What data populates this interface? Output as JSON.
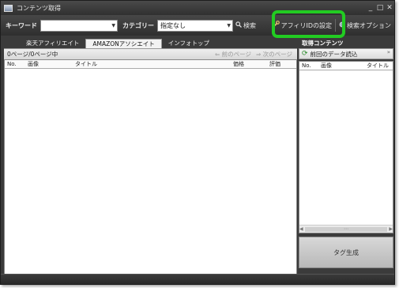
{
  "window": {
    "title": "コンテンツ取得",
    "min_symbol": "_",
    "max_symbol": "□",
    "close_symbol": "✕"
  },
  "toolbar": {
    "keyword_label": "キーワード",
    "keyword_value": "",
    "category_label": "カテゴリー",
    "category_value": "指定なし",
    "search_label": "検索",
    "affiliate_id_label": "アフィリIDの設定",
    "search_options_label": "検索オプション",
    "dropdown_symbol": "▼"
  },
  "tabs": [
    {
      "label": "楽天アフィリエイト",
      "active": false
    },
    {
      "label": "AMAZONアソシエイト",
      "active": true
    },
    {
      "label": "インフォトップ",
      "active": false
    }
  ],
  "pager": {
    "status": "0ページ/0ページ中",
    "prev": "⇐ 前のページ",
    "next": "⇒ 次のページ"
  },
  "grid": {
    "columns": [
      "No.",
      "画像",
      "タイトル",
      "価格",
      "評価"
    ]
  },
  "right_pane": {
    "title": "取得コンテンツ",
    "load_button": "前回のデータ読込",
    "chevron": "»",
    "columns": [
      "No.",
      "画像",
      "タイトル"
    ],
    "scroll_left": "◀",
    "scroll_thumb": "⋯",
    "scroll_right": "▶",
    "tag_button": "タグ生成"
  },
  "colors": {
    "highlight": "#22cc22",
    "chrome": "#3b3b3b"
  }
}
